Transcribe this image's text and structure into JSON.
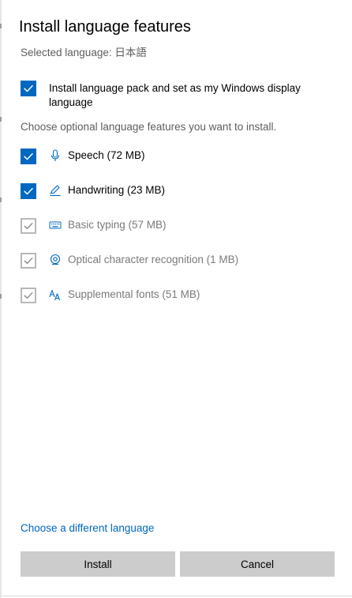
{
  "dialog": {
    "title": "Install language features",
    "selected_language_label": "Selected language: 日本語",
    "install_pack": {
      "checked": true,
      "label": "Install language pack and set as my Windows display language"
    },
    "optional_hint": "Choose optional language features you want to install.",
    "features": [
      {
        "label": "Speech (72 MB)",
        "icon": "microphone-icon",
        "checked": true,
        "enabled": true
      },
      {
        "label": "Handwriting (23 MB)",
        "icon": "pen-icon",
        "checked": true,
        "enabled": true
      },
      {
        "label": "Basic typing (57 MB)",
        "icon": "keyboard-icon",
        "checked": true,
        "enabled": false
      },
      {
        "label": "Optical character recognition (1 MB)",
        "icon": "ocr-icon",
        "checked": true,
        "enabled": false
      },
      {
        "label": "Supplemental fonts (51 MB)",
        "icon": "font-icon",
        "checked": true,
        "enabled": false
      }
    ],
    "change_language_link": "Choose a different language",
    "install_button": "Install",
    "cancel_button": "Cancel"
  },
  "colors": {
    "accent": "#0067c0",
    "button_bg": "#cccccc",
    "secondary_text": "#5d5d5d",
    "disabled_text": "#7a7a7a",
    "disabled_check": "#b8b8b8"
  }
}
